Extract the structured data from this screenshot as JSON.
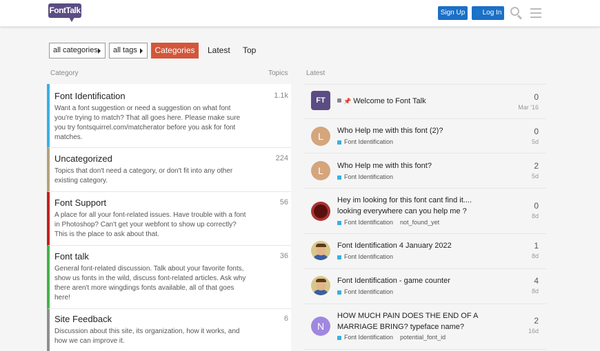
{
  "header": {
    "logo_text": "FontTalk",
    "signup_label": "Sign Up",
    "login_label": "Log In"
  },
  "nav": {
    "categories_dropdown": "all categories",
    "tags_dropdown": "all tags",
    "tabs": [
      "Categories",
      "Latest",
      "Top"
    ],
    "active_tab": "Categories"
  },
  "columns": {
    "category": "Category",
    "topics": "Topics",
    "latest": "Latest"
  },
  "categories": [
    {
      "name": "Font Identification",
      "count": "1.1k",
      "color": "#3ab0e1",
      "description": "Want a font suggestion or need a suggestion on what font you're trying to match? That all goes here. Please make sure you try fontsquirrel.com/matcherator before you ask for font matches."
    },
    {
      "name": "Uncategorized",
      "count": "224",
      "color": "#b3a27f",
      "description": "Topics that don't need a category, or don't fit into any other existing category."
    },
    {
      "name": "Font Support",
      "count": "56",
      "color": "#c32020",
      "description": "A place for all your font-related issues. Have trouble with a font in Photoshop? Can't get your webfont to show up correctly? This is the place to ask about that."
    },
    {
      "name": "Font talk",
      "count": "36",
      "color": "#43b24a",
      "description": "General font-related discussion. Talk about your favorite fonts, show us fonts in the wild, discuss font-related articles. Ask why there aren't more wingdings fonts available, all of that goes here!"
    },
    {
      "name": "Site Feedback",
      "count": "6",
      "color": "#8f8f8f",
      "description": "Discussion about this site, its organization, how it works, and how we can improve it."
    }
  ],
  "topics": [
    {
      "title": "Welcome to Font Talk",
      "category": "",
      "tag": "",
      "posts": "0",
      "age": "Mar '16",
      "avatar_letter": "FT",
      "avatar_color": "#5b4c83",
      "pinned": true
    },
    {
      "title": "Who Help me with this font (2)?",
      "category": "Font Identification",
      "tag": "",
      "posts": "0",
      "age": "5d",
      "avatar_letter": "L",
      "avatar_color": "#d5a57c",
      "pinned": false
    },
    {
      "title": "Who Help me with this font?",
      "category": "Font Identification",
      "tag": "",
      "posts": "2",
      "age": "5d",
      "avatar_letter": "L",
      "avatar_color": "#d5a57c",
      "pinned": false
    },
    {
      "title": "Hey im looking for this font cant find it.... looking everywhere can you help me ?",
      "category": "Font Identification",
      "tag": "not_found_yet",
      "posts": "0",
      "age": "8d",
      "avatar_letter": "",
      "avatar_color": "#8b1a1a",
      "pinned": false
    },
    {
      "title": "Font Identification 4 January 2022",
      "category": "Font Identification",
      "tag": "",
      "posts": "1",
      "age": "8d",
      "avatar_letter": "",
      "avatar_color": "#d9c68a",
      "pinned": false
    },
    {
      "title": "Font Identification - game counter",
      "category": "Font Identification",
      "tag": "",
      "posts": "4",
      "age": "8d",
      "avatar_letter": "",
      "avatar_color": "#d9c68a",
      "pinned": false
    },
    {
      "title": "HOW MUCH PAIN DOES THE END OF A MARRIAGE BRING? typeface name?",
      "category": "Font Identification",
      "tag": "potential_font_id",
      "posts": "2",
      "age": "16d",
      "avatar_letter": "N",
      "avatar_color": "#a087e0",
      "pinned": false
    }
  ]
}
